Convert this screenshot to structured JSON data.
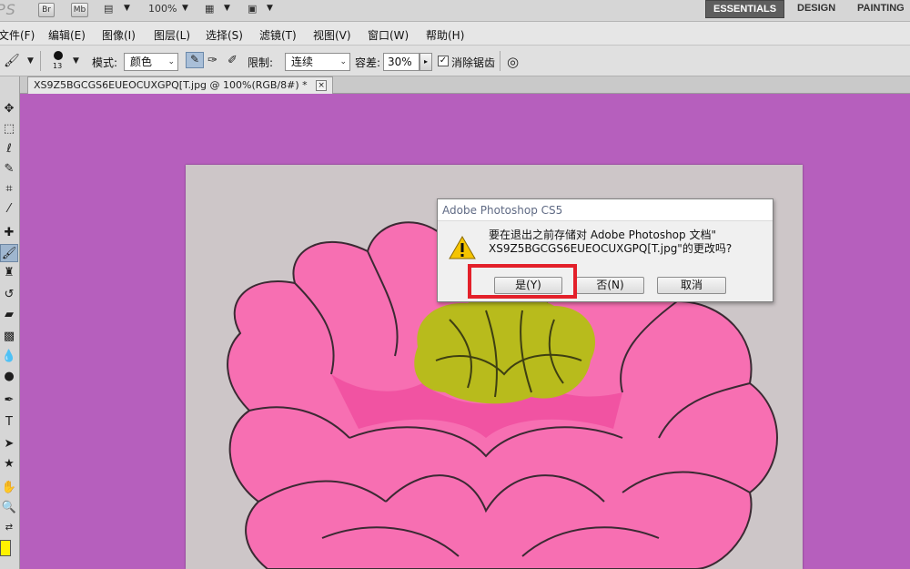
{
  "appbar": {
    "logo": "PS",
    "bridge_label": "Br",
    "minibridge_label": "Mb",
    "zoom": "100%",
    "workspaces": [
      "ESSENTIALS",
      "DESIGN",
      "PAINTING"
    ]
  },
  "menu": [
    "文件(F)",
    "编辑(E)",
    "图像(I)",
    "图层(L)",
    "选择(S)",
    "滤镜(T)",
    "视图(V)",
    "窗口(W)",
    "帮助(H)"
  ],
  "options": {
    "brush_size": "13",
    "mode_label": "模式:",
    "mode_value": "颜色",
    "limit_label": "限制:",
    "limit_value": "连续",
    "tolerance_label": "容差:",
    "tolerance_value": "30%",
    "antialias_label": "消除锯齿",
    "antialias_checked": true
  },
  "document": {
    "tab_title": "XS9Z5BGCGS6EUEOCUXGPQ[T.jpg @ 100%(RGB/8#) *",
    "close_glyph": "×"
  },
  "dialog": {
    "title": "Adobe Photoshop CS5",
    "message_line1": "要在退出之前存储对 Adobe Photoshop 文档\"",
    "message_line2": "XS9Z5BGCGS6EUEOCUXGPQ[T.jpg\"的更改吗?",
    "yes": "是(Y)",
    "no": "否(N)",
    "cancel": "取消"
  },
  "colors": {
    "canvas_background": "#b65fbd",
    "foreground_swatch": "#fff200",
    "highlight": "#e3202a",
    "petal": "#f76fb2",
    "petal_dark": "#ec3d95",
    "center": "#b8bb1c"
  }
}
